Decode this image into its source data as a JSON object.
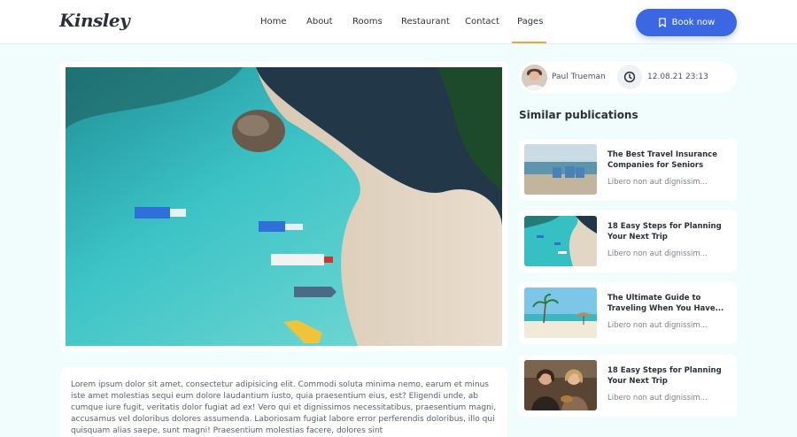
{
  "brand": {
    "logo": "Kinsley"
  },
  "nav": {
    "items": [
      {
        "label": "Home"
      },
      {
        "label": "About"
      },
      {
        "label": "Rooms"
      },
      {
        "label": "Restaurant"
      },
      {
        "label": "Contact"
      },
      {
        "label": "Pages",
        "active": true
      }
    ],
    "active_color": "#f0a23b"
  },
  "header": {
    "book_label": "Book now",
    "book_icon": "bookmark-icon",
    "accent": "#3c67e3"
  },
  "article": {
    "body": "Lorem ipsum dolor sit amet, consectetur adipisicing elit. Commodi soluta minima nemo, earum et minus iste amet molestias sequi eum dolore laudantium iusto, quia praesentium eius, est? Eligendi unde, ab cumque iure fugit, veritatis dolor fugiat ad ex! Vero qui et dignissimos necessitatibus, praesentium magni, accusamus vel doloribus dolores assumenda. Laboriosam fugiat labore error perferendis doloribus, illo qui quisquam alias saepe, sunt magni! Praesentium molestias facere, dolores sint"
  },
  "meta": {
    "author": "Paul Trueman",
    "datetime": "12.08.21 23:13",
    "clock_icon": "clock-icon"
  },
  "similar": {
    "title": "Similar publications",
    "items": [
      {
        "title": "The Best Travel Insurance Companies for Seniors",
        "excerpt": "Libero non aut dignissim..."
      },
      {
        "title": "18 Easy Steps for Planning Your Next Trip",
        "excerpt": "Libero non aut dignissim..."
      },
      {
        "title": "The Ultimate Guide to Traveling When You Have...",
        "excerpt": "Libero non aut dignissim..."
      },
      {
        "title": "18 Easy Steps for Planning Your Next Trip",
        "excerpt": "Libero non aut dignissim..."
      }
    ]
  }
}
